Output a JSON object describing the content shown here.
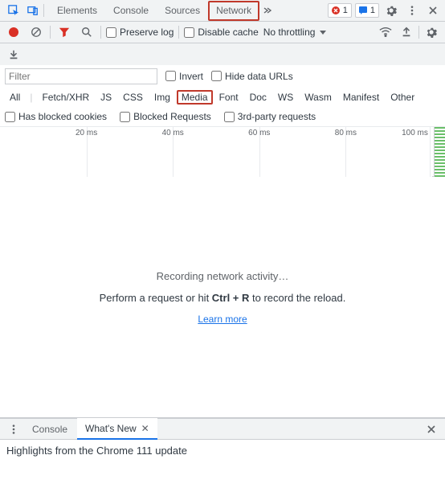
{
  "top_tabs": {
    "elements": "Elements",
    "console": "Console",
    "sources": "Sources",
    "network": "Network"
  },
  "top_right": {
    "error_count": "1",
    "info_count": "1"
  },
  "toolbar": {
    "preserve_log": "Preserve log",
    "disable_cache": "Disable cache",
    "throttling": "No throttling"
  },
  "filter": {
    "placeholder": "Filter",
    "invert": "Invert",
    "hide_data_urls": "Hide data URLs"
  },
  "type_filters": {
    "all": "All",
    "fetchxhr": "Fetch/XHR",
    "js": "JS",
    "css": "CSS",
    "img": "Img",
    "media": "Media",
    "font": "Font",
    "doc": "Doc",
    "ws": "WS",
    "wasm": "Wasm",
    "manifest": "Manifest",
    "other": "Other"
  },
  "blocked": {
    "has_blocked_cookies": "Has blocked cookies",
    "blocked_requests": "Blocked Requests",
    "third_party": "3rd-party requests"
  },
  "timeline": {
    "ticks": [
      "20 ms",
      "40 ms",
      "60 ms",
      "80 ms",
      "100 ms"
    ]
  },
  "empty_state": {
    "recording": "Recording network activity…",
    "hint_prefix": "Perform a request or hit ",
    "hint_shortcut": "Ctrl + R",
    "hint_suffix": " to record the reload.",
    "learn_more": "Learn more"
  },
  "drawer": {
    "console": "Console",
    "whats_new": "What's New",
    "body": "Highlights from the Chrome 111 update"
  }
}
